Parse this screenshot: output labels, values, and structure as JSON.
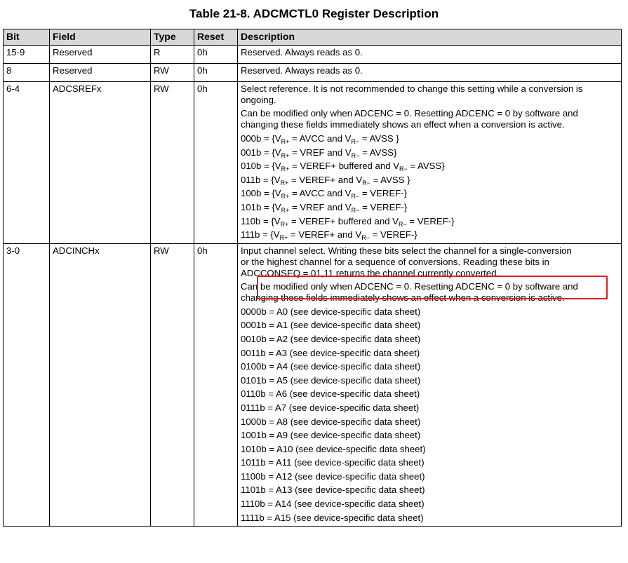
{
  "title": "Table 21-8. ADCMCTL0 Register Description",
  "headers": {
    "bit": "Bit",
    "field": "Field",
    "type": "Type",
    "reset": "Reset",
    "description": "Description"
  },
  "rows": [
    {
      "bit": "15-9",
      "field": "Reserved",
      "type": "R",
      "reset": "0h",
      "desc": "Reserved. Always reads as 0."
    },
    {
      "bit": "8",
      "field": "Reserved",
      "type": "RW",
      "reset": "0h",
      "desc": "Reserved. Always reads as 0."
    },
    {
      "bit": "6-4",
      "field": "ADCSREFx",
      "type": "RW",
      "reset": "0h",
      "desc_p1": "Select reference. It is not recommended to change this setting while a conversion is ongoing.",
      "desc_p2": "Can be modified only when ADCENC = 0. Resetting ADCENC = 0 by software and changing these fields immediately shows an effect when a conversion is active.",
      "options": [
        {
          "code": "000b = {V",
          "a": "R+",
          "b": " = AVCC and V",
          "c": "R−",
          "d": " = AVSS }"
        },
        {
          "code": "001b = {V",
          "a": "R+",
          "b": " = VREF and V",
          "c": "R−",
          "d": " = AVSS}"
        },
        {
          "code": "010b = {V",
          "a": "R+",
          "b": " = VEREF+ buffered and V",
          "c": "R−",
          "d": " = AVSS}"
        },
        {
          "code": "011b = {V",
          "a": "R+",
          "b": " = VEREF+ and V",
          "c": "R−",
          "d": " = AVSS }"
        },
        {
          "code": "100b = {V",
          "a": "R+",
          "b": " = AVCC and V",
          "c": "R−",
          "d": " = VEREF-}"
        },
        {
          "code": "101b = {V",
          "a": "R+",
          "b": " = VREF and V",
          "c": "R−",
          "d": " = VEREF-}"
        },
        {
          "code": "110b = {V",
          "a": "R+",
          "b": " = VEREF+ buffered and V",
          "c": "R−",
          "d": " = VEREF-}"
        },
        {
          "code": "111b = {V",
          "a": "R+",
          "b": " = VEREF+ and V",
          "c": "R−",
          "d": " = VEREF-}"
        }
      ]
    },
    {
      "bit": "3-0",
      "field": "ADCINCHx",
      "type": "RW",
      "reset": "0h",
      "desc_p1a": "Input channel select. Writing these bits select the channel for a single-conversion",
      "desc_p1b": "or the highest channel for a sequence of conversions. Reading these bits in",
      "desc_p1c": "ADCCONSEQ = 01,11 returns the channel currently converted.",
      "desc_p2": "Can be modified only when ADCENC = 0. Resetting ADCENC = 0 by software and changing these fields immediately shows an effect when a conversion is active.",
      "channels": [
        "0000b = A0 (see device-specific data sheet)",
        "0001b = A1 (see device-specific data sheet)",
        "0010b = A2 (see device-specific data sheet)",
        "0011b = A3 (see device-specific data sheet)",
        "0100b = A4 (see device-specific data sheet)",
        "0101b = A5 (see device-specific data sheet)",
        "0110b = A6 (see device-specific data sheet)",
        "0111b = A7 (see device-specific data sheet)",
        "1000b = A8 (see device-specific data sheet)",
        "1001b = A9 (see device-specific data sheet)",
        "1010b = A10 (see device-specific data sheet)",
        "1011b = A11 (see device-specific data sheet)",
        "1100b = A12 (see device-specific data sheet)",
        "1101b = A13 (see device-specific data sheet)",
        "1110b = A14 (see device-specific data sheet)",
        "1111b = A15 (see device-specific data sheet)"
      ]
    }
  ],
  "highlight_color": "#e02020"
}
